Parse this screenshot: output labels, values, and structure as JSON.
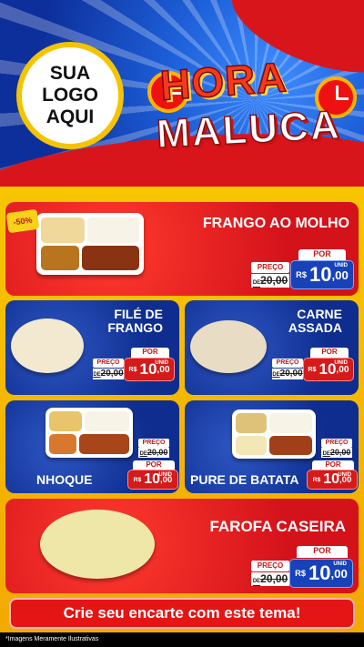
{
  "header": {
    "logo_text": "SUA\nLOGO\nAQUI",
    "title_line1": "HORA",
    "title_line2": "MALUCA"
  },
  "badge": "-50%",
  "products": [
    {
      "name": "FRANGO AO MOLHO",
      "preco_label": "PREÇO",
      "old_price": "20,00",
      "old_prefix": "DE",
      "por_label": "POR",
      "currency": "R$",
      "price_int": "10",
      "price_dec": ",00",
      "unit": "UNID"
    },
    {
      "name": "FILÉ DE FRANGO",
      "preco_label": "PREÇO",
      "old_price": "20,00",
      "old_prefix": "DE",
      "por_label": "POR",
      "currency": "R$",
      "price_int": "10",
      "price_dec": ",00",
      "unit": "UNID"
    },
    {
      "name": "CARNE ASSADA",
      "preco_label": "PREÇO",
      "old_price": "20,00",
      "old_prefix": "DE",
      "por_label": "POR",
      "currency": "R$",
      "price_int": "10",
      "price_dec": ",00",
      "unit": "UNID"
    },
    {
      "name": "NHOQUE",
      "preco_label": "PREÇO",
      "old_price": "20,00",
      "old_prefix": "DE",
      "por_label": "POR",
      "currency": "R$",
      "price_int": "10",
      "price_dec": ",00",
      "unit": "UNID"
    },
    {
      "name": "PURE DE BATATA",
      "preco_label": "PREÇO",
      "old_price": "20,00",
      "old_prefix": "DE",
      "por_label": "POR",
      "currency": "R$",
      "price_int": "10",
      "price_dec": ",00",
      "unit": "UNID"
    },
    {
      "name": "FAROFA CASEIRA",
      "preco_label": "PREÇO",
      "old_price": "20,00",
      "old_prefix": "DE",
      "por_label": "POR",
      "currency": "R$",
      "price_int": "10",
      "price_dec": ",00",
      "unit": "UNID"
    }
  ],
  "cta": "Crie seu encarte com este tema!",
  "footer_note": "*Imagens Meramente Ilustrativas",
  "colors": {
    "red": "#d4121a",
    "blue": "#0e2d8e",
    "yellow": "#f7c600"
  }
}
